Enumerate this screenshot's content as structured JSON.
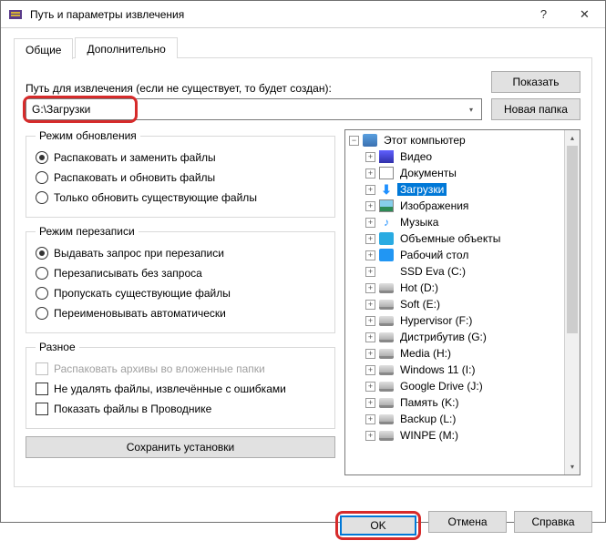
{
  "window": {
    "title": "Путь и параметры извлечения"
  },
  "tabs": {
    "general": "Общие",
    "advanced": "Дополнительно",
    "active": 0
  },
  "path": {
    "label": "Путь для извлечения (если не существует, то будет создан):",
    "value": "G:\\Загрузки"
  },
  "buttons": {
    "show": "Показать",
    "new_folder": "Новая папка",
    "save_settings": "Сохранить установки",
    "ok": "OK",
    "cancel": "Отмена",
    "help": "Справка"
  },
  "groups": {
    "update_mode": {
      "legend": "Режим обновления",
      "options": [
        "Распаковать и заменить файлы",
        "Распаковать и обновить файлы",
        "Только обновить существующие файлы"
      ],
      "selected": 0
    },
    "overwrite_mode": {
      "legend": "Режим перезаписи",
      "options": [
        "Выдавать запрос при перезаписи",
        "Перезаписывать без запроса",
        "Пропускать существующие файлы",
        "Переименовывать автоматически"
      ],
      "selected": 0
    },
    "misc": {
      "legend": "Разное",
      "options": [
        {
          "label": "Распаковать архивы во вложенные папки",
          "disabled": true
        },
        {
          "label": "Не удалять файлы, извлечённые с ошибками",
          "disabled": false
        },
        {
          "label": "Показать файлы в Проводнике",
          "disabled": false
        }
      ]
    }
  },
  "tree": {
    "root": "Этот компьютер",
    "children": [
      {
        "label": "Видео",
        "icon": "vid"
      },
      {
        "label": "Документы",
        "icon": "doc"
      },
      {
        "label": "Загрузки",
        "icon": "dl",
        "selected": true
      },
      {
        "label": "Изображения",
        "icon": "img"
      },
      {
        "label": "Музыка",
        "icon": "mus"
      },
      {
        "label": "Объемные объекты",
        "icon": "3d"
      },
      {
        "label": "Рабочий стол",
        "icon": "desk"
      },
      {
        "label": "SSD Eva (C:)",
        "icon": "win"
      },
      {
        "label": "Hot (D:)",
        "icon": "drv"
      },
      {
        "label": "Soft (E:)",
        "icon": "drv"
      },
      {
        "label": "Hypervisor (F:)",
        "icon": "drv"
      },
      {
        "label": "Дистрибутив (G:)",
        "icon": "drv"
      },
      {
        "label": "Media (H:)",
        "icon": "drv"
      },
      {
        "label": "Windows 11 (I:)",
        "icon": "drv"
      },
      {
        "label": "Google Drive (J:)",
        "icon": "drv"
      },
      {
        "label": "Память (K:)",
        "icon": "drv"
      },
      {
        "label": "Backup (L:)",
        "icon": "drv"
      },
      {
        "label": "WINPE (M:)",
        "icon": "drv"
      }
    ]
  }
}
